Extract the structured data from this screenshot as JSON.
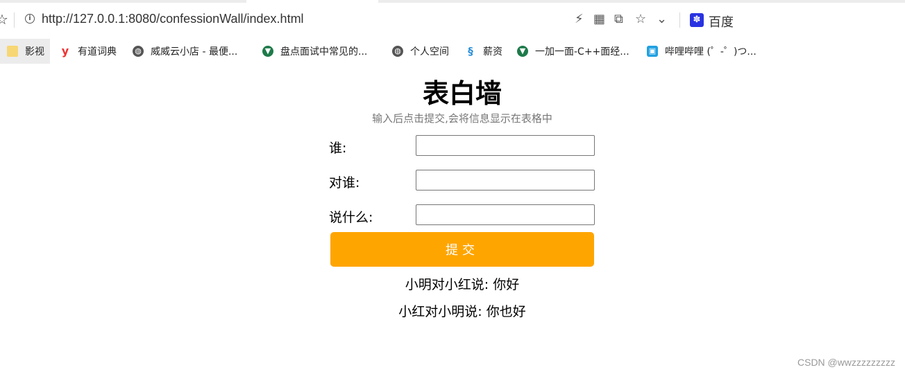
{
  "browser": {
    "url": "http://127.0.0.1:8080/confessionWall/index.html",
    "search_engine_label": "百度",
    "bookmarks": [
      {
        "label": "影视",
        "icon": "folder-icon"
      },
      {
        "label": "有道词典",
        "icon": "youdao-icon"
      },
      {
        "label": "威威云小店 - 最便...",
        "icon": "globe-icon"
      },
      {
        "label": "盘点面试中常见的...",
        "icon": "site-icon"
      },
      {
        "label": "个人空间",
        "icon": "globe-icon"
      },
      {
        "label": "薪资",
        "icon": "site-icon"
      },
      {
        "label": "一加一面-C++面经...",
        "icon": "site-icon"
      },
      {
        "label": "哔哩哔哩 (゜-゜)つ...",
        "icon": "bilibili-icon"
      }
    ]
  },
  "page": {
    "title": "表白墙",
    "subtitle": "输入后点击提交,会将信息显示在表格中",
    "form": {
      "from_label": "谁:",
      "from_value": "",
      "to_label": "对谁:",
      "to_value": "",
      "message_label": "说什么:",
      "message_value": "",
      "submit_label": "提交"
    },
    "messages": [
      "小明对小红说: 你好",
      "小红对小明说: 你也好"
    ],
    "watermark": "CSDN @wwzzzzzzzzz"
  },
  "colors": {
    "submit_button": "#ffa500",
    "subtitle_text": "#777777"
  }
}
